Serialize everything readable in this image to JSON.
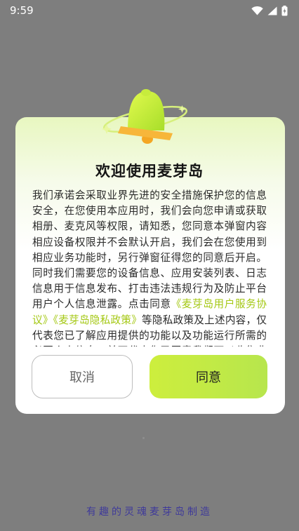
{
  "status_bar": {
    "time": "9:59",
    "icons": [
      "wifi-icon",
      "signal-icon",
      "battery-icon"
    ]
  },
  "dialog": {
    "title": "欢迎使用麦芽岛",
    "body_before": "我们承诺会采取业界先进的安全措施保护您的信息安全，在您使用本应用时，我们会向您申请或获取相册、麦克风等权限，请知悉，您同意本弹窗内容相应设备权限并不会默认开启，我们会在您使用到相应业务功能时，另行弹窗征得您的同意后开启。同时我们需要您的设备信息、应用安装列表、日志信息用于信息发布、打击违法违规行为及防止平台用户个人信息泄露。点击同意",
    "link_service": "《麦芽岛用户服务协议》",
    "link_privacy": "《麦芽岛隐私政策》",
    "body_after": "等隐私政策及上述内容，仅代表您已了解应用提供的功能以及功能运行所需的必要个人信息，并不代表您已同意我们可以收集非必要个人信息。",
    "cancel_label": "取消",
    "agree_label": "同意"
  },
  "footer": {
    "slogan": "有趣的灵魂麦芽岛制造"
  },
  "colors": {
    "accent": "#c6ec3c",
    "link": "#a4c813",
    "overlay": "#7e7e7e",
    "slogan": "#3f3a9a"
  }
}
